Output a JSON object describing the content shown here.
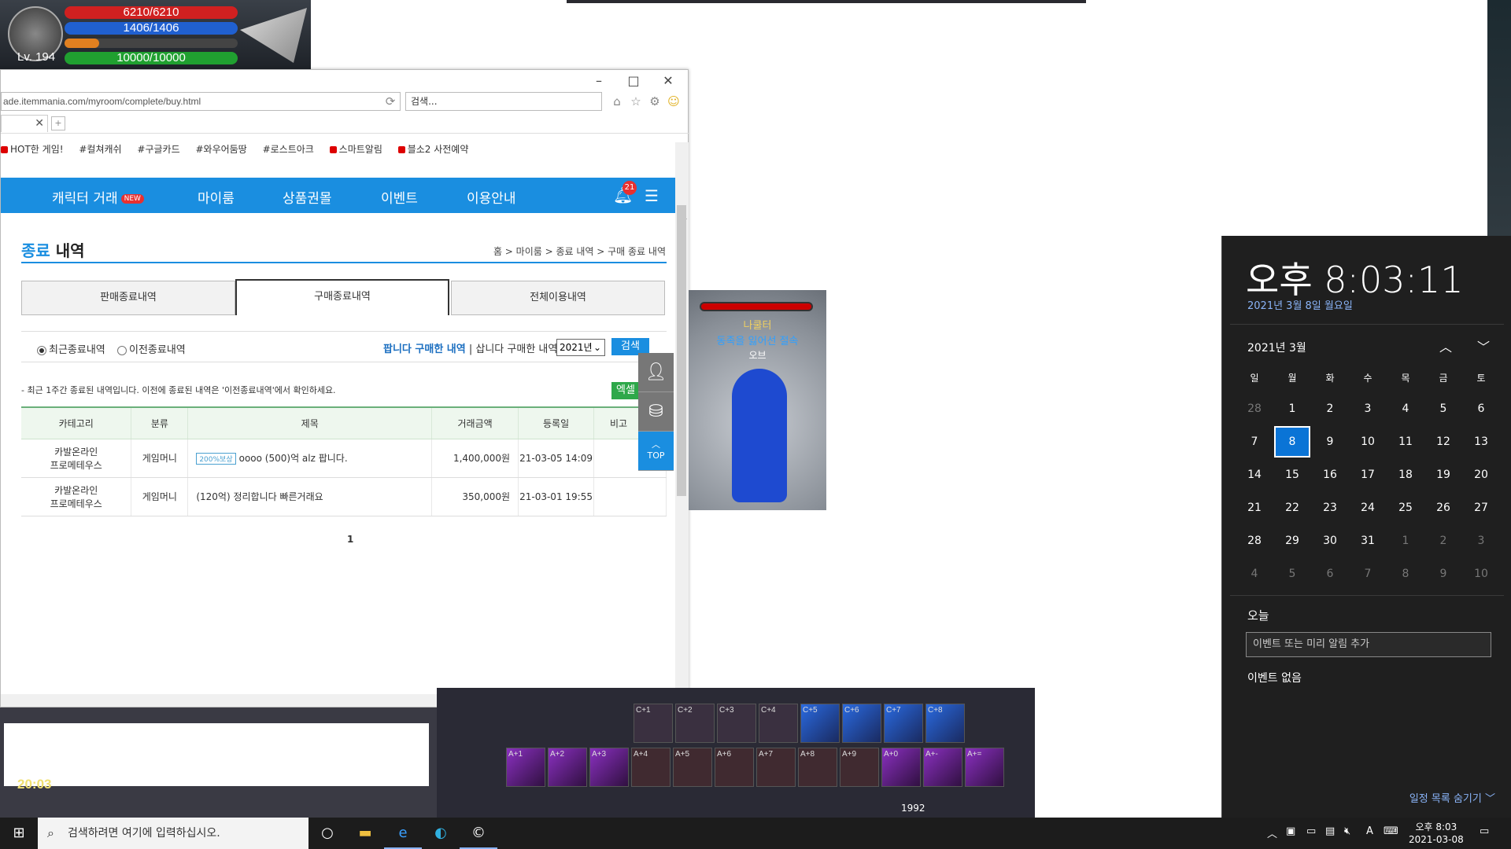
{
  "hud": {
    "hp": "6210/6210",
    "mp": "1406/1406",
    "exp": "10000/10000",
    "level": "Lv. 194",
    "game_clock": "20:03"
  },
  "pet": {
    "name": "나쿨터",
    "title": "동족을 잃어선 절속",
    "tag": "오브"
  },
  "browser": {
    "address": "ade.itemmania.com/myroom/complete/buy.html",
    "search_placeholder": "검색...",
    "tags": [
      "HOT한 게임!",
      "#컬쳐캐쉬",
      "#구글카드",
      "#와우어둠땅",
      "#로스트아크",
      "스마트알림",
      "블소2 사전예약"
    ],
    "nav": {
      "character": "캐릭터 거래",
      "new_badge": "NEW",
      "myroom": "마이룸",
      "giftcard": "상품권몰",
      "event": "이벤트",
      "guide": "이용안내",
      "bell_count": "21"
    },
    "title_blue": "종료",
    "title_rest": " 내역",
    "breadcrumb": "홈 > 마이룸 > 종료 내역 > 구매 종료 내역",
    "tabs": [
      "판매종료내역",
      "구매종료내역",
      "전체이용내역"
    ],
    "filter": {
      "recent": "최근종료내역",
      "previous": "이전종료내역",
      "sell_link": "팝니다 구매한 내역",
      "sep": " | ",
      "buy_link": "삽니다 구매한 내역",
      "year": "2021년",
      "search_btn": "검색"
    },
    "notice": "- 최근 1주간 종료된 내역입니다. 이전에 종료된 내역은 '이전종료내역'에서 확인하세요.",
    "excel_btn": "엑셀",
    "columns": [
      "카테고리",
      "분류",
      "제목",
      "거래금액",
      "등록일",
      "비고"
    ],
    "rows": [
      {
        "cat1": "카발온라인",
        "cat2": "프로메테우스",
        "type": "게임머니",
        "badge": "200%보상",
        "title": "oooo (500)억 alz 팝니다.",
        "amount": "1,400,000원",
        "date": "21-03-05 14:09"
      },
      {
        "cat1": "카발온라인",
        "cat2": "프로메테우스",
        "type": "게임머니",
        "badge": "",
        "title": "(120억) 정리합니다 빠른거래요",
        "amount": "350,000원",
        "date": "21-03-01 19:55"
      }
    ],
    "page": "1",
    "top_btn": "TOP"
  },
  "calendar": {
    "time": "오후 8:03:11",
    "date_long": "2021년 3월 8일 월요일",
    "month": "2021년 3월",
    "weekdays": [
      "일",
      "월",
      "화",
      "수",
      "목",
      "금",
      "토"
    ],
    "days": [
      "28",
      "1",
      "2",
      "3",
      "4",
      "5",
      "6",
      "7",
      "8",
      "9",
      "10",
      "11",
      "12",
      "13",
      "14",
      "15",
      "16",
      "17",
      "18",
      "19",
      "20",
      "21",
      "22",
      "23",
      "24",
      "25",
      "26",
      "27",
      "28",
      "29",
      "30",
      "31",
      "1",
      "2",
      "3",
      "4",
      "5",
      "6",
      "7",
      "8",
      "9",
      "10"
    ],
    "today_label": "오늘",
    "event_placeholder": "이벤트 또는 미리 알림 추가",
    "no_event": "이벤트 없음",
    "hide": "일정 목록 숨기기"
  },
  "taskbar": {
    "search": "검색하려면 여기에 입력하십시오.",
    "time": "오후 8:03",
    "date": "2021-03-08",
    "ime": "A"
  },
  "skills_row1": [
    "C+1",
    "C+2",
    "C+3",
    "C+4",
    "C+5",
    "C+6",
    "C+7",
    "C+8"
  ],
  "skills_row2": [
    "A+1",
    "A+2",
    "A+3",
    "A+4",
    "A+5",
    "A+6",
    "A+7",
    "A+8",
    "A+9",
    "A+0",
    "A+-",
    "A+="
  ],
  "skill_count": "1992"
}
